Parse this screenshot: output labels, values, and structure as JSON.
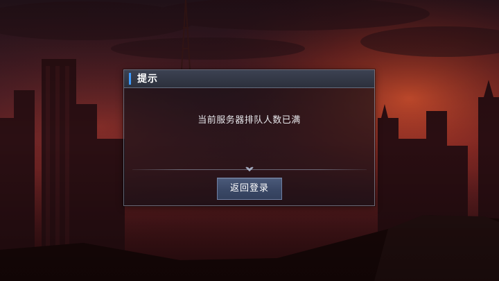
{
  "dialog": {
    "title": "提示",
    "message": "当前服务器排队人数已满",
    "return_button_label": "返回登录"
  },
  "colors": {
    "accent": "#3f9bff",
    "button": "#3a4866",
    "sky_top": "#3a1e2a",
    "sky_glow": "#d8462c"
  },
  "icons": {
    "divider_ornament": "diamond-chevron-icon"
  }
}
